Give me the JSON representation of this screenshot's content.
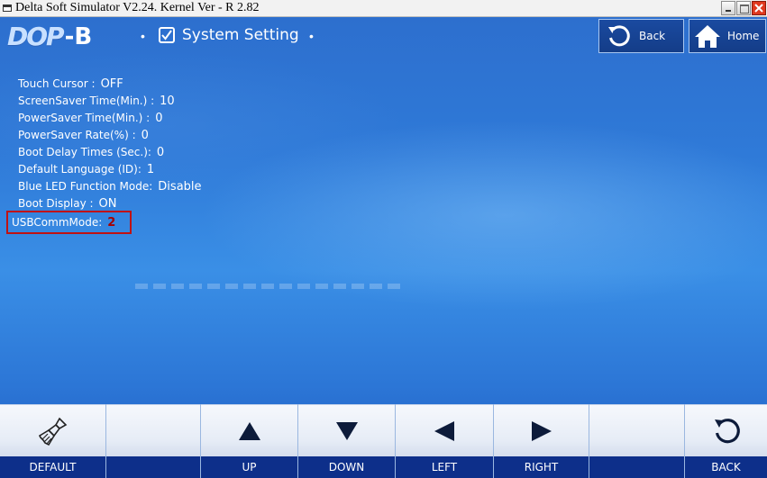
{
  "window": {
    "title": "Delta Soft Simulator V2.24. Kernel Ver - R 2.82"
  },
  "header": {
    "logo_text": "DOP",
    "logo_suffix": "-B",
    "separator": "•",
    "title": "System Setting",
    "back_label": "Back",
    "home_label": "Home"
  },
  "settings": [
    {
      "label": "Touch Cursor :",
      "value": "OFF"
    },
    {
      "label": "ScreenSaver Time(Min.) :",
      "value": "10"
    },
    {
      "label": "PowerSaver Time(Min.) :",
      "value": "0"
    },
    {
      "label": "PowerSaver Rate(%) :",
      "value": "0"
    },
    {
      "label": "Boot Delay Times (Sec.):",
      "value": "0"
    },
    {
      "label": "Default Language (ID):",
      "value": "1"
    },
    {
      "label": "Blue LED Function Mode:",
      "value": "Disable"
    },
    {
      "label": "Boot Display :",
      "value": "ON"
    },
    {
      "label": "USBCommMode:",
      "value": "2"
    }
  ],
  "softkeys": [
    {
      "label": "DEFAULT",
      "icon": "broom-icon"
    },
    {
      "label": "",
      "icon": ""
    },
    {
      "label": "UP",
      "icon": "arrow-up-icon"
    },
    {
      "label": "DOWN",
      "icon": "arrow-down-icon"
    },
    {
      "label": "LEFT",
      "icon": "arrow-left-icon"
    },
    {
      "label": "RIGHT",
      "icon": "arrow-right-icon"
    },
    {
      "label": "",
      "icon": ""
    },
    {
      "label": "BACK",
      "icon": "back-circle-icon"
    }
  ],
  "colors": {
    "screen_blue": "#2f7ad8",
    "softkey_navy": "#0d2f8a",
    "highlight_red": "#c01212",
    "value_red": "#a70000"
  }
}
